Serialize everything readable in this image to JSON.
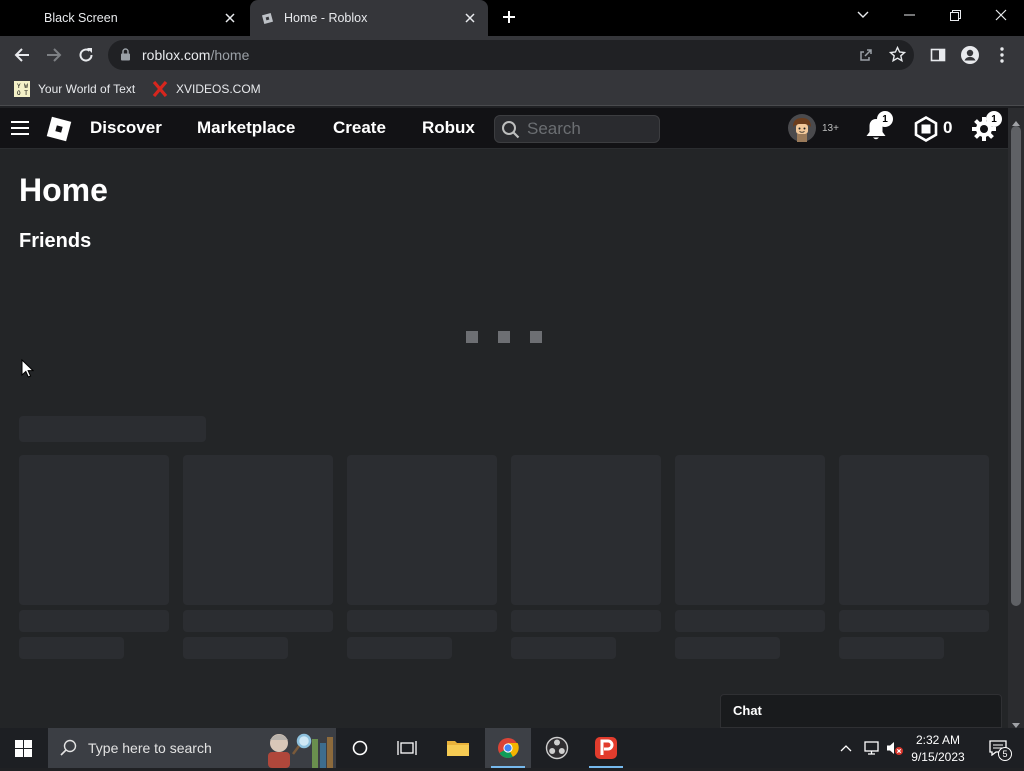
{
  "browser": {
    "tabs": [
      {
        "title": "Black Screen",
        "active": false
      },
      {
        "title": "Home - Roblox",
        "active": true
      }
    ],
    "url_host": "roblox.com",
    "url_path": "/home",
    "bookmarks": [
      {
        "label": "Your World of Text",
        "icon": "ywot-icon"
      },
      {
        "label": "XVIDEOS.COM",
        "icon": "x-icon"
      }
    ]
  },
  "roblox": {
    "nav": {
      "discover": "Discover",
      "marketplace": "Marketplace",
      "create": "Create",
      "robux": "Robux",
      "search_placeholder": "Search",
      "age_label": "13+",
      "notification_count": "1",
      "robux_balance": "0",
      "settings_badge": "1"
    },
    "page_title": "Home",
    "friends_heading": "Friends",
    "chat_label": "Chat",
    "accent_color": "#ffffff",
    "background_color": "#232527"
  },
  "taskbar": {
    "search_placeholder": "Type here to search",
    "time": "2:32 AM",
    "date": "9/15/2023",
    "notification_count": "5"
  }
}
